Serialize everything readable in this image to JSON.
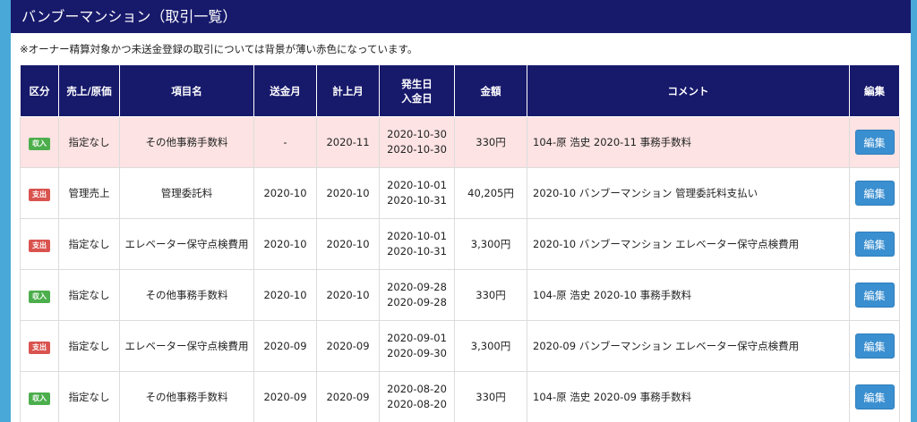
{
  "title": "バンブーマンション（取引一覧）",
  "note": "※オーナー精算対象かつ未送金登録の取引については背景が薄い赤色になっています。",
  "headers": {
    "category": "区分",
    "sales_cost": "売上/原価",
    "item": "項目名",
    "remit_month": "送金月",
    "book_month": "計上月",
    "dates_line1": "発生日",
    "dates_line2": "入金日",
    "amount": "金額",
    "comment": "コメント",
    "edit": "編集"
  },
  "edit_label": "編集",
  "colors": {
    "header_bg": "#17196b",
    "income_badge": "#4cae4c",
    "expense_badge": "#d9534f",
    "pink_row": "#fde3e3",
    "edit_button": "#3a8fd0"
  },
  "rows": [
    {
      "type": "income",
      "badge": "収入",
      "sales_cost": "指定なし",
      "item": "その他事務手数料",
      "remit_month": "-",
      "book_month": "2020-11",
      "occurred": "2020-10-30",
      "paid": "2020-10-30",
      "amount": "330円",
      "comment": "104-原 浩史 2020-11 事務手数料",
      "highlighted": true
    },
    {
      "type": "expense",
      "badge": "支出",
      "sales_cost": "管理売上",
      "item": "管理委託料",
      "remit_month": "2020-10",
      "book_month": "2020-10",
      "occurred": "2020-10-01",
      "paid": "2020-10-31",
      "amount": "40,205円",
      "comment": "2020-10 バンブーマンション 管理委託料支払い",
      "highlighted": false
    },
    {
      "type": "expense",
      "badge": "支出",
      "sales_cost": "指定なし",
      "item": "エレベーター保守点検費用",
      "remit_month": "2020-10",
      "book_month": "2020-10",
      "occurred": "2020-10-01",
      "paid": "2020-10-31",
      "amount": "3,300円",
      "comment": "2020-10 バンブーマンション エレベーター保守点検費用",
      "highlighted": false
    },
    {
      "type": "income",
      "badge": "収入",
      "sales_cost": "指定なし",
      "item": "その他事務手数料",
      "remit_month": "2020-10",
      "book_month": "2020-10",
      "occurred": "2020-09-28",
      "paid": "2020-09-28",
      "amount": "330円",
      "comment": "104-原 浩史 2020-10 事務手数料",
      "highlighted": false
    },
    {
      "type": "expense",
      "badge": "支出",
      "sales_cost": "指定なし",
      "item": "エレベーター保守点検費用",
      "remit_month": "2020-09",
      "book_month": "2020-09",
      "occurred": "2020-09-01",
      "paid": "2020-09-30",
      "amount": "3,300円",
      "comment": "2020-09 バンブーマンション エレベーター保守点検費用",
      "highlighted": false
    },
    {
      "type": "income",
      "badge": "収入",
      "sales_cost": "指定なし",
      "item": "その他事務手数料",
      "remit_month": "2020-09",
      "book_month": "2020-09",
      "occurred": "2020-08-20",
      "paid": "2020-08-20",
      "amount": "330円",
      "comment": "104-原 浩史 2020-09 事務手数料",
      "highlighted": false
    }
  ]
}
